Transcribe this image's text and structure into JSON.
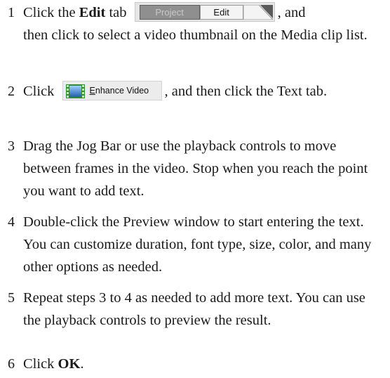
{
  "steps": [
    {
      "num": "1",
      "pre": "Click the ",
      "bold": "Edit",
      "mid": " tab ",
      "post": ", and",
      "rest": "then click to select a video thumbnail on the Media clip list."
    },
    {
      "num": "2",
      "pre": "Click ",
      "post": ", and then click the Text tab."
    },
    {
      "num": "3",
      "text": "Drag the Jog Bar or use the playback controls to move between frames in the video. Stop when you reach the point you want to add text."
    },
    {
      "num": "4",
      "text": "Double-click the Preview window to start entering the text. You can customize duration, font type, size, color, and many other options as needed."
    },
    {
      "num": "5",
      "text": "Repeat steps 3 to 4 as needed to add more text. You can use the playback controls to preview the result."
    },
    {
      "num": "6",
      "pre": "Click ",
      "bold": "OK",
      "post": "."
    }
  ],
  "tab_control": {
    "project_label": "Project",
    "edit_label": "Edit"
  },
  "enhance_button": {
    "mnemonic": "E",
    "label_rest": "nhance Video",
    "icon": "film-strip-icon"
  }
}
